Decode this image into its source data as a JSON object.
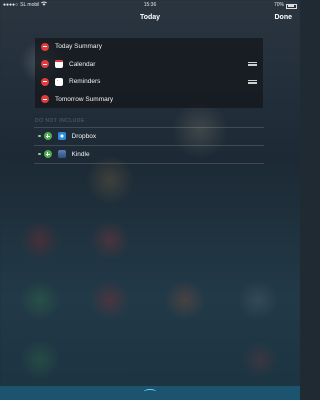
{
  "status_bar": {
    "signal_dots": "●●●●○",
    "carrier": "SL mobil",
    "wifi_icon": "wifi-icon",
    "time": "15:36",
    "battery_text": "70%",
    "battery_level": 0.7
  },
  "header": {
    "title": "Today",
    "done_label": "Done"
  },
  "enabled_widgets": [
    {
      "label": "Today Summary",
      "icon": null,
      "reorderable": false
    },
    {
      "label": "Calendar",
      "icon": "calendar-icon",
      "reorderable": true
    },
    {
      "label": "Reminders",
      "icon": "reminders-icon",
      "reorderable": true
    },
    {
      "label": "Tomorrow Summary",
      "icon": null,
      "reorderable": false
    }
  ],
  "available_section": {
    "header": "DO NOT INCLUDE",
    "items": [
      {
        "label": "Dropbox",
        "icon": "dropbox-icon"
      },
      {
        "label": "Kindle",
        "icon": "kindle-icon"
      }
    ]
  },
  "colors": {
    "remove_red": "#e13b3b",
    "add_green": "#4caf50",
    "handle_blue": "#5fd3ff"
  }
}
